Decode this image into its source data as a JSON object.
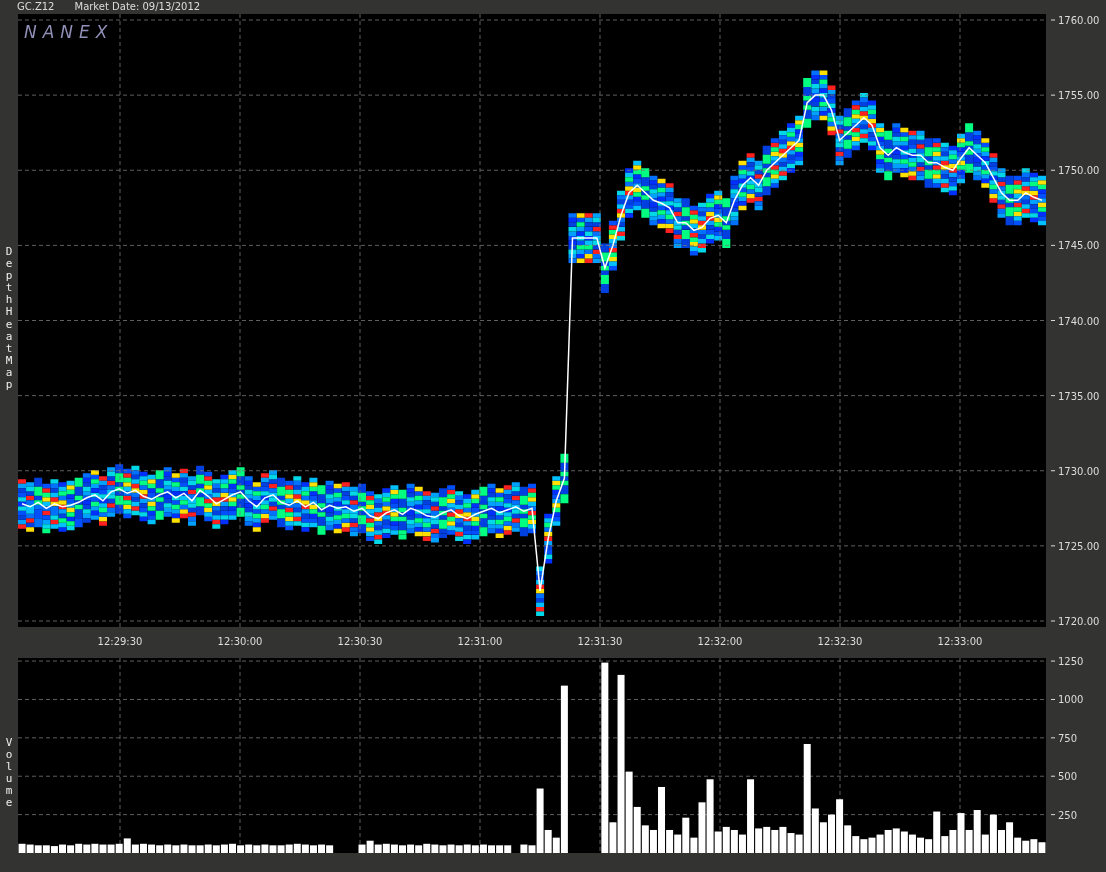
{
  "header": {
    "symbol": "GC.Z12",
    "market_date": "Market Date: 09/13/2012"
  },
  "price_pane": {
    "logo": "NANEX",
    "axis_label": "Depth Heat Map",
    "chart_data": {
      "type": "line",
      "grid": true,
      "ylim": [
        1719.6,
        1760.4
      ],
      "yticks": [
        {
          "value": 1760,
          "label": "1760.00"
        },
        {
          "value": 1755,
          "label": "1755.00"
        },
        {
          "value": 1750,
          "label": "1750.00"
        },
        {
          "value": 1745,
          "label": "1745.00"
        },
        {
          "value": 1740,
          "label": "1740.00"
        },
        {
          "value": 1735,
          "label": "1735.00"
        },
        {
          "value": 1730,
          "label": "1730.00"
        },
        {
          "value": 1725,
          "label": "1725.00"
        },
        {
          "value": 1720,
          "label": "1720.00"
        }
      ],
      "series": [
        {
          "color": "#ffffff",
          "values": [
            1727.8,
            1727.6,
            1727.9,
            1727.5,
            1727.8,
            1727.6,
            1727.7,
            1727.9,
            1728.2,
            1728.4,
            1728.0,
            1728.6,
            1728.8,
            1728.5,
            1728.7,
            1728.3,
            1728.1,
            1728.4,
            1728.6,
            1728.2,
            1728.5,
            1728.0,
            1728.7,
            1728.3,
            1727.8,
            1728.1,
            1728.4,
            1728.6,
            1728.0,
            1727.6,
            1728.2,
            1728.4,
            1727.9,
            1727.7,
            1728.0,
            1727.6,
            1727.9,
            1727.4,
            1727.7,
            1727.5,
            1727.6,
            1727.3,
            1727.5,
            1727.0,
            1726.8,
            1727.2,
            1727.4,
            1727.1,
            1727.5,
            1727.3,
            1727.0,
            1726.9,
            1727.2,
            1727.4,
            1727.0,
            1726.8,
            1727.1,
            1727.3,
            1727.5,
            1727.2,
            1727.4,
            1727.6,
            1727.3,
            1727.5,
            1722.0,
            1725.5,
            1728.0,
            1729.5,
            1745.5,
            1745.5,
            1745.5,
            1745.5,
            1743.5,
            1745.0,
            1747.0,
            1748.5,
            1749.0,
            1748.5,
            1748.0,
            1747.8,
            1747.5,
            1746.5,
            1746.5,
            1746.0,
            1746.2,
            1746.8,
            1747.0,
            1746.5,
            1748.0,
            1749.0,
            1749.5,
            1749.0,
            1750.0,
            1750.5,
            1751.0,
            1751.5,
            1752.0,
            1754.5,
            1755.0,
            1755.0,
            1754.0,
            1752.0,
            1752.5,
            1753.0,
            1753.5,
            1753.0,
            1751.5,
            1751.0,
            1751.5,
            1751.2,
            1751.0,
            1751.0,
            1750.5,
            1750.5,
            1750.2,
            1750.0,
            1750.8,
            1751.5,
            1751.0,
            1750.5,
            1749.5,
            1748.5,
            1748.0,
            1748.0,
            1748.5,
            1748.2,
            1748.0
          ]
        }
      ]
    }
  },
  "time_axis": [
    "12:29:30",
    "12:30:00",
    "12:30:30",
    "12:31:00",
    "12:31:30",
    "12:32:00",
    "12:32:30",
    "12:33:00"
  ],
  "volume_pane": {
    "axis_label": "Volume",
    "chart_data": {
      "type": "bar",
      "grid": true,
      "ylim": [
        0,
        1270
      ],
      "yticks": [
        {
          "value": 250,
          "label": "250"
        },
        {
          "value": 500,
          "label": "500"
        },
        {
          "value": 750,
          "label": "750"
        },
        {
          "value": 1000,
          "label": "1000"
        },
        {
          "value": 1250,
          "label": "1250"
        }
      ],
      "values": [
        60,
        55,
        50,
        50,
        45,
        55,
        50,
        60,
        55,
        60,
        55,
        55,
        60,
        95,
        55,
        60,
        55,
        50,
        55,
        50,
        55,
        50,
        50,
        55,
        50,
        55,
        60,
        50,
        55,
        50,
        55,
        50,
        50,
        55,
        60,
        55,
        50,
        55,
        50,
        null,
        null,
        null,
        55,
        80,
        55,
        60,
        55,
        50,
        55,
        50,
        60,
        55,
        50,
        55,
        50,
        55,
        50,
        55,
        50,
        50,
        50,
        null,
        55,
        50,
        420,
        150,
        100,
        1090,
        null,
        null,
        null,
        null,
        1240,
        200,
        1160,
        530,
        300,
        180,
        150,
        430,
        150,
        120,
        230,
        100,
        330,
        480,
        140,
        170,
        150,
        120,
        480,
        160,
        170,
        150,
        170,
        130,
        120,
        710,
        290,
        200,
        250,
        350,
        180,
        110,
        90,
        100,
        120,
        150,
        160,
        140,
        120,
        100,
        90,
        270,
        110,
        150,
        260,
        150,
        280,
        120,
        250,
        150,
        200,
        100,
        80,
        90,
        70
      ]
    }
  }
}
